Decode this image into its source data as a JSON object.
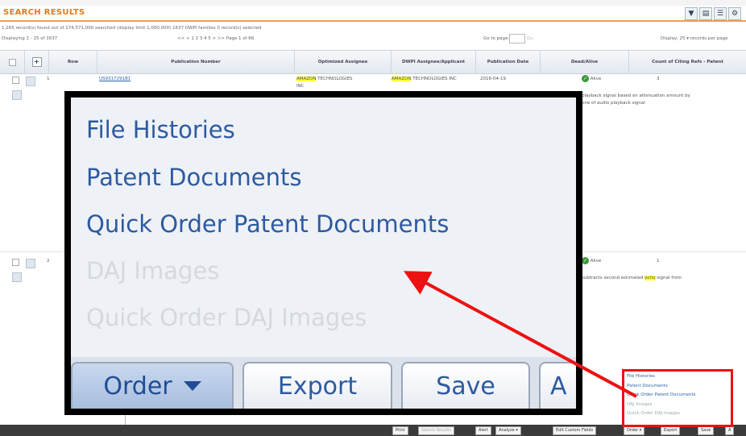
{
  "header": {
    "title": "SEARCH RESULTS",
    "summary": "1,265 record(s) found out of 174,571,000 searched (display limit 1,000,000)     1637 DWPI families     0 record(s) selected",
    "displaying": "Displaying 1 - 25 of 1637",
    "pager": "<< < 1 2 3 4 5 > >>  Page 1 of 66",
    "go_to_page": "Go to page:",
    "go_label": "Go",
    "per_page": "Display: 25 ▾ records per page"
  },
  "table": {
    "columns": [
      "Row",
      "Publication Number",
      "Optimized Assignee",
      "DWPI Assignee/Applicant",
      "Publication Date",
      "Dead/Alive",
      "Count of Citing Refs - Patent"
    ],
    "rows": [
      {
        "row": "1",
        "publication_number": "US9317291B1",
        "optimized_assignee_hl": "AMAZON",
        "optimized_assignee_rest": " TECHNOLOGIES",
        "optimized_assignee_line2": "INC",
        "dwpi_assignee_hl": "AMAZON",
        "dwpi_assignee_rest": " TECHNOLOGIES INC",
        "publication_date": "2016-04-19",
        "status": "Alive",
        "citing_count": "3",
        "snippet_line1": "playback signal based on attenuation amount by",
        "snippet_line2": "one of audio playback signal"
      },
      {
        "row": "2",
        "status": "Alive",
        "citing_count": "1",
        "snippet_pre": "subtracts second estimated ",
        "snippet_hl": "echo",
        "snippet_post": " signal from"
      }
    ]
  },
  "zoom_menu": {
    "items": [
      {
        "label": "File Histories",
        "enabled": true
      },
      {
        "label": "Patent Documents",
        "enabled": true
      },
      {
        "label": "Quick Order Patent Documents",
        "enabled": true
      },
      {
        "label": "DAJ Images",
        "enabled": false
      },
      {
        "label": "Quick Order DAJ Images",
        "enabled": false
      }
    ],
    "buttons": {
      "order": "Order",
      "export": "Export",
      "save": "Save",
      "partial": "A"
    }
  },
  "footer": {
    "buttons": [
      "Print",
      "Search Results",
      "Alert",
      "Analyze ▾",
      "Edit Custom Fields",
      "Order ▾",
      "Export",
      "Save",
      "A"
    ]
  },
  "mini_menu": {
    "items": [
      "File Histories",
      "Patent Documents",
      "Quick Order Patent Documents",
      "DAJ Images",
      "Quick Order DAJ Images"
    ]
  },
  "misc": {
    "partial_text": "He"
  },
  "colors": {
    "title_orange": "#e07b1e",
    "link_blue": "#2a64a8",
    "highlight": "#ffff33",
    "callout_red": "#ee1111"
  }
}
